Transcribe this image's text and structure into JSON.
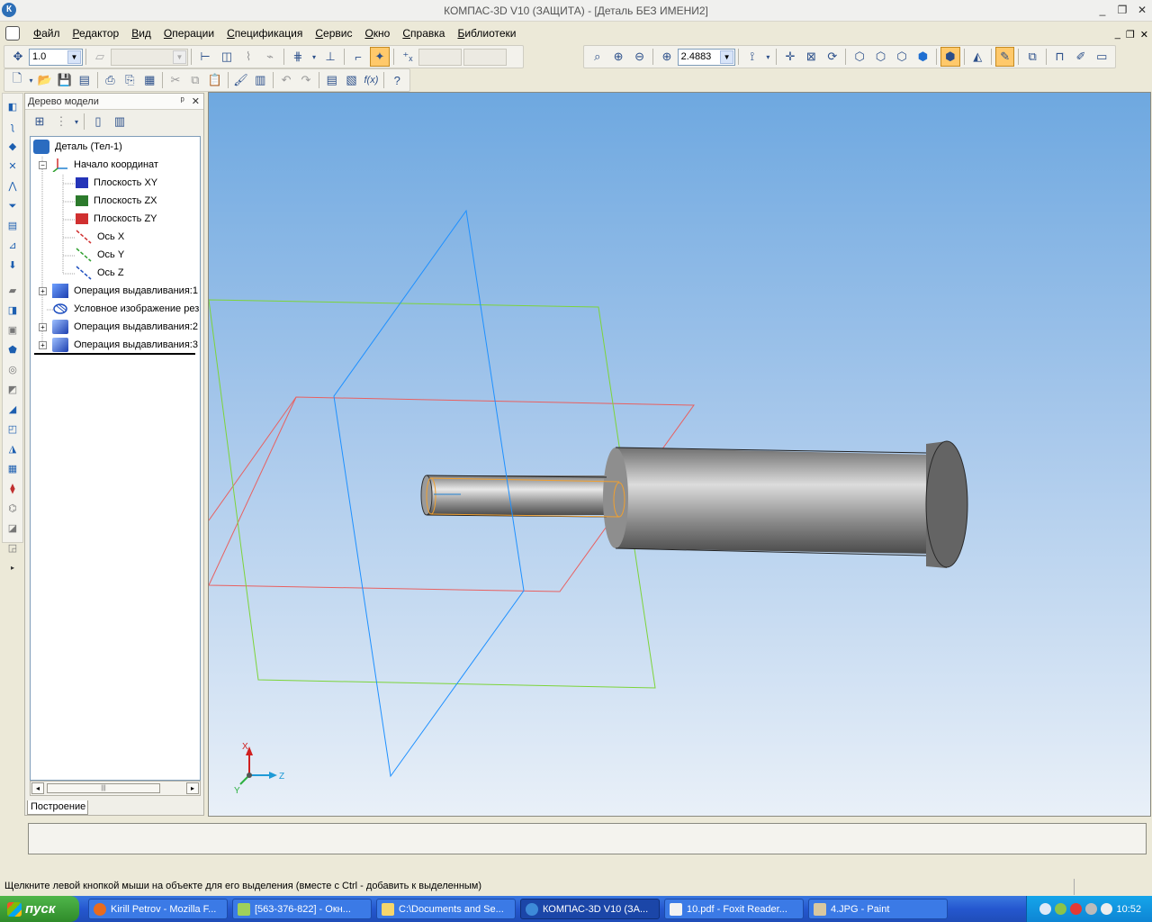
{
  "window": {
    "title": "КОМПАС-3D V10 (ЗАЩИТА) - [Деталь БЕЗ ИМЕНИ2]",
    "app_icon_letter": "К",
    "min_glyph": "_",
    "max_glyph": "❐",
    "close_glyph": "✕"
  },
  "menu": [
    "Файл",
    "Редактор",
    "Вид",
    "Операции",
    "Спецификация",
    "Сервис",
    "Окно",
    "Справка",
    "Библиотеки"
  ],
  "toolbar": {
    "step_value": "1.0",
    "zoom_value": "2.4883",
    "function_label": "f(x)"
  },
  "tree": {
    "panel_title": "Дерево модели",
    "pin_glyph": "ᵖ",
    "close_glyph": "✕",
    "nodes": [
      {
        "label": "Деталь (Тел-1)"
      },
      {
        "label": "Начало координат"
      },
      {
        "label": "Плоскость XY"
      },
      {
        "label": "Плоскость ZX"
      },
      {
        "label": "Плоскость ZY"
      },
      {
        "label": "Ось X"
      },
      {
        "label": "Ось Y"
      },
      {
        "label": "Ось Z"
      },
      {
        "label": "Операция выдавливания:1"
      },
      {
        "label": "Условное изображение резьбы"
      },
      {
        "label": "Операция выдавливания:2"
      },
      {
        "label": "Операция выдавливания:3"
      }
    ],
    "tab_label": "Построение",
    "expand_glyph": "+",
    "collapse_glyph": "−"
  },
  "axes": {
    "x_label": "X",
    "y_label": "Y",
    "z_label": "Z"
  },
  "status": {
    "hint": "Щелкните левой кнопкой мыши на объекте для его выделения (вместе с Ctrl - добавить к выделенным)"
  },
  "taskbar": {
    "start_label": "пуск",
    "tasks": [
      {
        "label": "Kirill Petrov - Mozilla F..."
      },
      {
        "label": "[563-376-822] - Окн..."
      },
      {
        "label": "C:\\Documents and Se..."
      },
      {
        "label": "КОМПАС-3D V10 (ЗА..."
      },
      {
        "label": "10.pdf - Foxit Reader..."
      },
      {
        "label": "4.JPG - Paint"
      }
    ],
    "clock": "10:52"
  },
  "colors": {
    "plane_xy": "#1e90ff",
    "plane_zx": "#7cd43a",
    "plane_zy": "#e86060",
    "part": "#8a8a8a"
  }
}
